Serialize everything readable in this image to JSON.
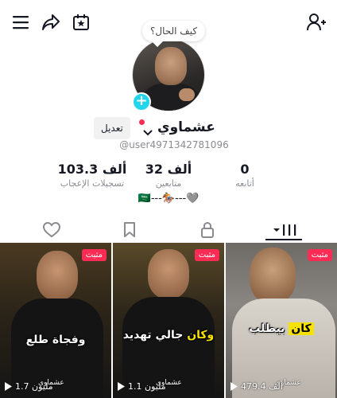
{
  "topbar": {
    "icons": [
      "menu-icon",
      "share-icon",
      "calendar-star-icon",
      "add-friend-icon"
    ]
  },
  "bubble_text": "كيف الحال؟",
  "profile": {
    "name": "عشماوي",
    "handle": "@user4971342781096",
    "edit_label": "تعديل",
    "bio": "🇸🇦---🏇---🩶"
  },
  "stats": [
    {
      "value": "0",
      "label": "أتابعه"
    },
    {
      "value": "32 ألف",
      "label": "متابعين"
    },
    {
      "value": "103.3 ألف",
      "label": "تسجيلات الإعجاب"
    }
  ],
  "tabs": [
    "videos-tab",
    "private-tab",
    "saved-tab",
    "liked-tab"
  ],
  "videos": [
    {
      "caption": "وفجاة طلع",
      "views": "1.7 مليون",
      "pinned_label": "مثبت",
      "watermark": "عشماوي"
    },
    {
      "caption_a": "وكان",
      "caption_b": "جالي تهديد",
      "views": "1.1 مليون",
      "pinned_label": "مثبت",
      "watermark": "عشماوي"
    },
    {
      "caption_a": "كان",
      "caption_b": "بيطلب",
      "views": "479.4 ألف",
      "pinned_label": "مثبت",
      "watermark": "عشماوي"
    }
  ],
  "colors": {
    "accent": "#fe2c55",
    "plus": "#20d5ec",
    "highlight": "#f6e200"
  }
}
